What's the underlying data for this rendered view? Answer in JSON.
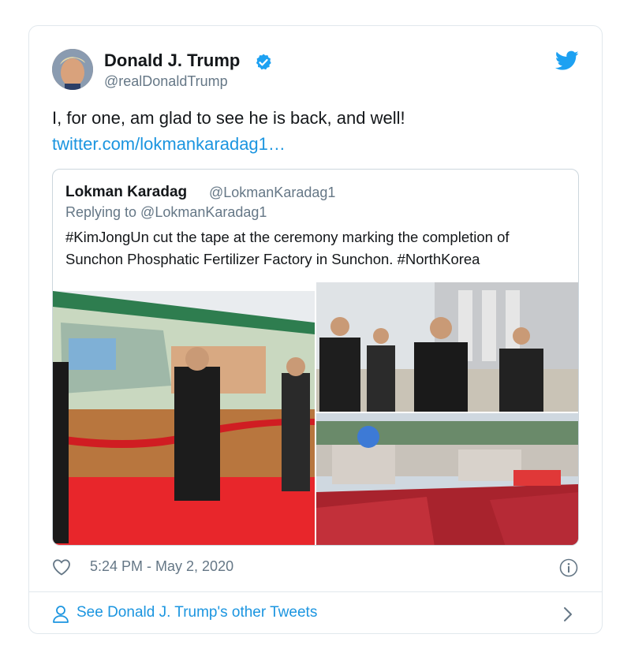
{
  "author": {
    "name": "Donald J. Trump",
    "handle": "@realDonaldTrump"
  },
  "tweet": {
    "text": "I, for one, am glad to see he is back, and well!",
    "link": "twitter.com/lokmankaradag1…"
  },
  "quoted_tweet": {
    "name": "Lokman Karadag",
    "handle": "@LokmanKaradag1",
    "reply_to": "Replying to @LokmanKaradag1",
    "text": "#KimJongUn cut the tape at the ceremony marking the completion of Sunchon Phosphatic Fertilizer Factory in Sunchon. #NorthKorea"
  },
  "footer": {
    "timestamp": "5:24 PM - May 2, 2020",
    "other_tweets_label": "See Donald J. Trump's other Tweets"
  },
  "icons": {
    "verified": "verified-badge-icon",
    "brand": "twitter-bird-icon",
    "like": "heart-icon",
    "info": "info-icon",
    "person": "person-icon",
    "chevron": "chevron-right-icon"
  },
  "colors": {
    "link": "#1b95e0",
    "secondary_text": "#657786",
    "border": "#e1e8ed"
  }
}
